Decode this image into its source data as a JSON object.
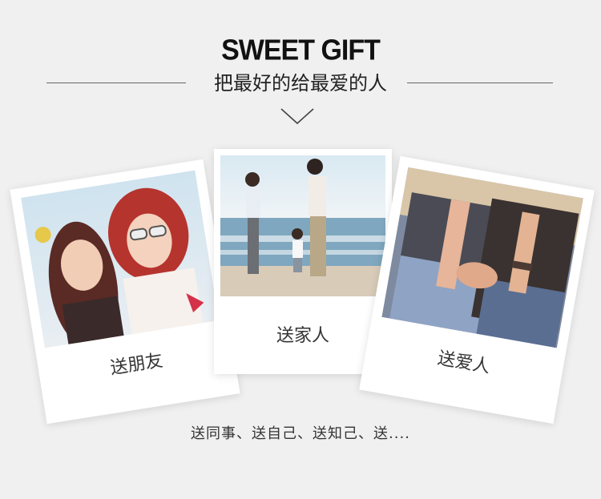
{
  "header": {
    "title": "SWEET GIFT",
    "subtitle": "把最好的给最爱的人"
  },
  "cards": [
    {
      "caption": "送朋友"
    },
    {
      "caption": "送家人"
    },
    {
      "caption": "送爱人"
    }
  ],
  "footer": {
    "text": "送同事、送自己、送知己、送...."
  },
  "colors": {
    "background": "#f0f0f0",
    "card": "#ffffff",
    "text": "#333333"
  }
}
